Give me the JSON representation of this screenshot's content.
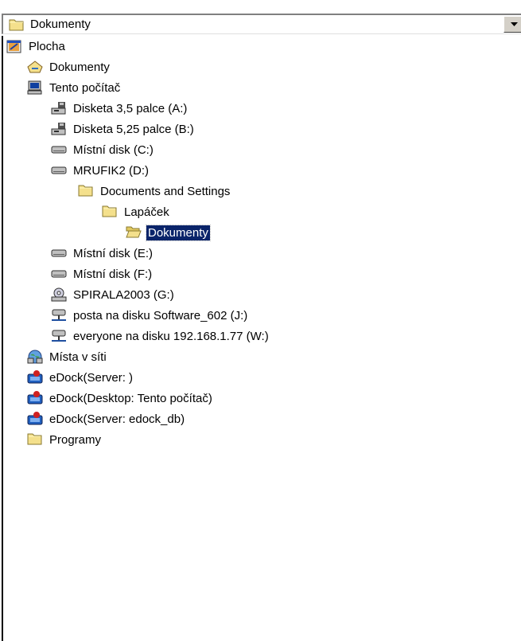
{
  "combo": {
    "value": "Dokumenty",
    "icon": "folder-icon"
  },
  "items": [
    {
      "label": "Plocha",
      "icon": "desktop-icon"
    },
    {
      "label": "Dokumenty",
      "icon": "my-documents-icon"
    },
    {
      "label": "Tento počítač",
      "icon": "computer-icon"
    },
    {
      "label": "Disketa 3,5 palce (A:)",
      "icon": "floppy-drive-icon"
    },
    {
      "label": "Disketa 5,25 palce (B:)",
      "icon": "floppy-drive-icon"
    },
    {
      "label": "Místní disk (C:)",
      "icon": "hard-disk-icon"
    },
    {
      "label": "MRUFIK2 (D:)",
      "icon": "hard-disk-icon"
    },
    {
      "label": "Documents and Settings",
      "icon": "folder-icon"
    },
    {
      "label": "Lapáček",
      "icon": "folder-icon"
    },
    {
      "label": "Dokumenty",
      "icon": "open-folder-icon",
      "selected": true
    },
    {
      "label": "Místní disk (E:)",
      "icon": "hard-disk-icon"
    },
    {
      "label": "Místní disk (F:)",
      "icon": "hard-disk-icon"
    },
    {
      "label": "SPIRALA2003 (G:)",
      "icon": "cd-drive-icon"
    },
    {
      "label": "posta na disku Software_602 (J:)",
      "icon": "network-drive-icon"
    },
    {
      "label": "everyone na disku 192.168.1.77 (W:)",
      "icon": "network-drive-icon"
    },
    {
      "label": "Místa v síti",
      "icon": "network-places-icon"
    },
    {
      "label": "eDock(Server: )",
      "icon": "edock-icon"
    },
    {
      "label": "eDock(Desktop: Tento počítač)",
      "icon": "edock-icon"
    },
    {
      "label": "eDock(Server: edock_db)",
      "icon": "edock-icon"
    },
    {
      "label": "Programy",
      "icon": "folder-icon"
    }
  ]
}
